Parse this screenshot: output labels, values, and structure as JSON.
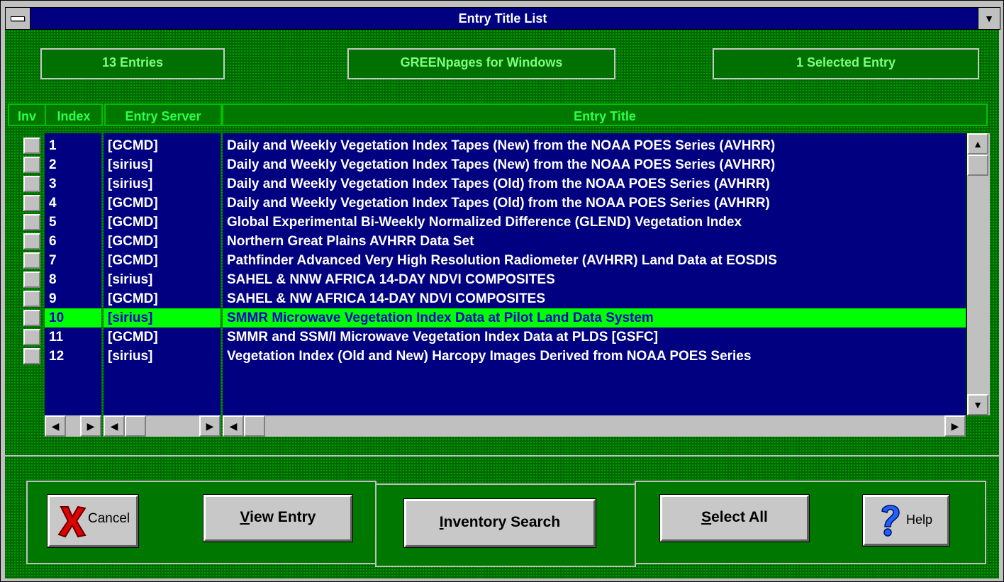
{
  "window": {
    "title": "Entry Title List"
  },
  "status": {
    "entries": "13 Entries",
    "app_name": "GREENpages for Windows",
    "selected": "1 Selected Entry"
  },
  "columns": {
    "inv": "Inv",
    "index": "Index",
    "server": "Entry Server",
    "title": "Entry Title"
  },
  "rows": [
    {
      "index": "1",
      "server": "[GCMD]",
      "title": "Daily and Weekly Vegetation Index Tapes (New) from the NOAA POES Series (AVHRR)"
    },
    {
      "index": "2",
      "server": "[sirius]",
      "title": "Daily and Weekly Vegetation Index Tapes (New) from the NOAA POES Series (AVHRR)"
    },
    {
      "index": "3",
      "server": "[sirius]",
      "title": "Daily and Weekly Vegetation Index Tapes (Old) from the NOAA POES Series (AVHRR)"
    },
    {
      "index": "4",
      "server": "[GCMD]",
      "title": "Daily and Weekly Vegetation Index Tapes (Old) from the NOAA POES Series (AVHRR)"
    },
    {
      "index": "5",
      "server": "[GCMD]",
      "title": "Global Experimental Bi-Weekly Normalized Difference (GLEND) Vegetation Index"
    },
    {
      "index": "6",
      "server": "[GCMD]",
      "title": "Northern Great Plains AVHRR Data Set"
    },
    {
      "index": "7",
      "server": "[GCMD]",
      "title": "Pathfinder Advanced Very High Resolution Radiometer (AVHRR)  Land Data at EOSDIS"
    },
    {
      "index": "8",
      "server": "[sirius]",
      "title": "SAHEL & NNW AFRICA 14-DAY NDVI COMPOSITES"
    },
    {
      "index": "9",
      "server": "[GCMD]",
      "title": "SAHEL & NW AFRICA 14-DAY NDVI COMPOSITES"
    },
    {
      "index": "10",
      "server": "[sirius]",
      "title": "SMMR Microwave Vegetation Index Data at Pilot Land Data System",
      "selected": true
    },
    {
      "index": "11",
      "server": "[GCMD]",
      "title": "SMMR and SSM/I Microwave Vegetation Index Data at  PLDS [GSFC]"
    },
    {
      "index": "12",
      "server": "[sirius]",
      "title": "Vegetation Index (Old and New) Harcopy Images Derived from NOAA POES Series"
    }
  ],
  "buttons": {
    "cancel": "Cancel",
    "view_entry_u": "V",
    "view_entry_rest": "iew Entry",
    "inventory_u": "I",
    "inventory_rest": "nventory Search",
    "select_all_u": "S",
    "select_all_rest": "elect All",
    "help": "Help"
  },
  "icons": {
    "cancel": "red-x-icon",
    "help": "question-mark-icon",
    "scroll_up": "arrow-up-icon",
    "scroll_down": "arrow-down-icon",
    "scroll_left": "arrow-left-icon",
    "scroll_right": "arrow-right-icon"
  },
  "colors": {
    "title_bar": "#000080",
    "list_bg": "#000080",
    "selected_row": "#00ff00",
    "client_bg": "#006800"
  }
}
